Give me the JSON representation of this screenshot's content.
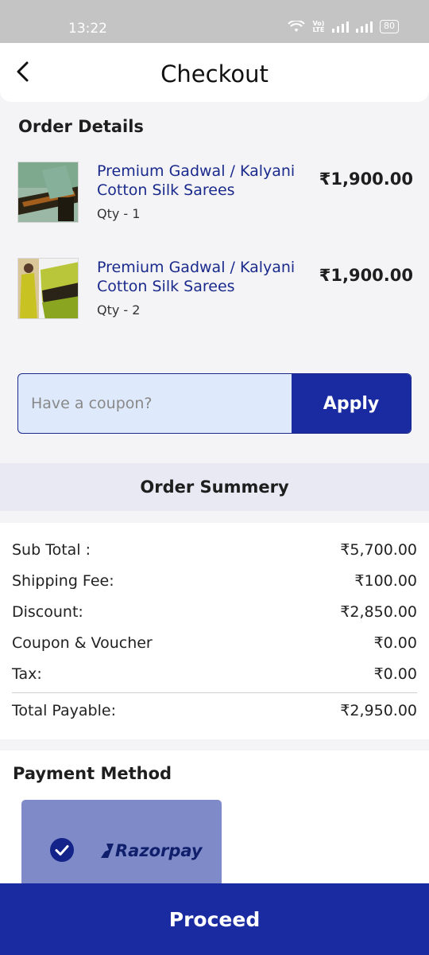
{
  "status_bar": {
    "time": "13:22",
    "network_label": "Vo) LTE",
    "battery": "80"
  },
  "header": {
    "title": "Checkout"
  },
  "order": {
    "section_title": "Order Details",
    "items": [
      {
        "name": "Premium Gadwal / Kalyani Cotton Silk Sarees",
        "qty": "Qty -  1",
        "price": "₹1,900.00"
      },
      {
        "name": "Premium Gadwal / Kalyani Cotton Silk Sarees",
        "qty": "Qty -  2",
        "price": "₹1,900.00"
      }
    ]
  },
  "coupon": {
    "placeholder": "Have a coupon?",
    "value": "",
    "apply_label": "Apply"
  },
  "summary": {
    "title": "Order Summery",
    "rows": [
      {
        "label": "Sub Total :",
        "value": "₹5,700.00"
      },
      {
        "label": "Shipping Fee:",
        "value": "₹100.00"
      },
      {
        "label": "Discount:",
        "value": "₹2,850.00"
      },
      {
        "label": "Coupon & Voucher",
        "value": "₹0.00"
      },
      {
        "label": "Tax:",
        "value": "₹0.00"
      }
    ],
    "total": {
      "label": "Total Payable:",
      "value": "₹2,950.00"
    }
  },
  "payment": {
    "title": "Payment Method",
    "options": [
      {
        "name": "Razorpay",
        "selected": true
      }
    ]
  },
  "footer": {
    "proceed_label": "Proceed"
  },
  "colors": {
    "primary": "#1a2aa0",
    "link_text": "#1a2a8c",
    "coupon_bg": "#deeafc",
    "card_bg": "#7f8ac8"
  },
  "icons": [
    "back-arrow-icon",
    "wifi-icon",
    "signal-icon",
    "battery-icon",
    "check-circle-icon",
    "razorpay-logo"
  ]
}
